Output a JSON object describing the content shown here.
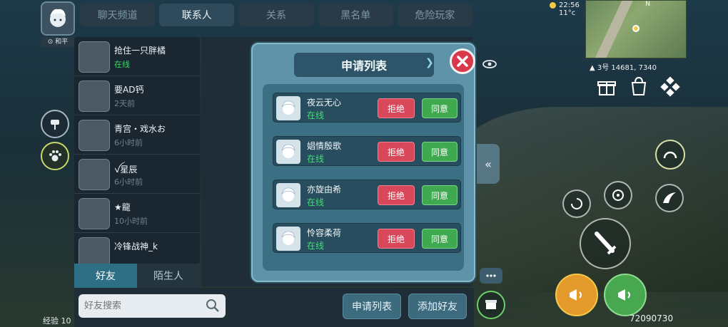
{
  "self": {
    "tag": "和平"
  },
  "tabs": [
    "聊天频道",
    "联系人",
    "关系",
    "黑名单",
    "危险玩家"
  ],
  "active_tab": 1,
  "friends": [
    {
      "name": "抢住一只胖橘",
      "status": "在线",
      "online": true
    },
    {
      "name": "要AD钙",
      "status": "2天前",
      "online": false
    },
    {
      "name": "青宫・戏水お",
      "status": "6小时前",
      "online": false
    },
    {
      "name": "ꪜ星辰",
      "status": "6小时前",
      "online": false
    },
    {
      "name": "★龍",
      "status": "10小时前",
      "online": false
    },
    {
      "name": "冷锋战神_k",
      "status": "",
      "online": false
    }
  ],
  "bottom_tabs": [
    "好友",
    "陌生人"
  ],
  "search": {
    "placeholder": "好友搜索"
  },
  "footer_buttons": {
    "requests": "申请列表",
    "add_friend": "添加好友"
  },
  "modal": {
    "title": "申请列表",
    "requests": [
      {
        "name": "夜云无心",
        "status": "在线",
        "reject": "拒绝",
        "agree": "同意"
      },
      {
        "name": "娼情殷歌",
        "status": "在线",
        "reject": "拒绝",
        "agree": "同意"
      },
      {
        "name": "亦旋由希",
        "status": "在线",
        "reject": "拒绝",
        "agree": "同意"
      },
      {
        "name": "怜容柔荷",
        "status": "在线",
        "reject": "拒绝",
        "agree": "同意"
      }
    ]
  },
  "hud": {
    "time": "22:56",
    "temp": "11°c",
    "compass": "N",
    "location": "3号 14681, 7340",
    "uid": "72090730",
    "exp_label": "经验 10"
  },
  "colors": {
    "online": "#3fe070",
    "reject": "#d9475b",
    "agree": "#3ea94f",
    "close": "#d9384d"
  }
}
